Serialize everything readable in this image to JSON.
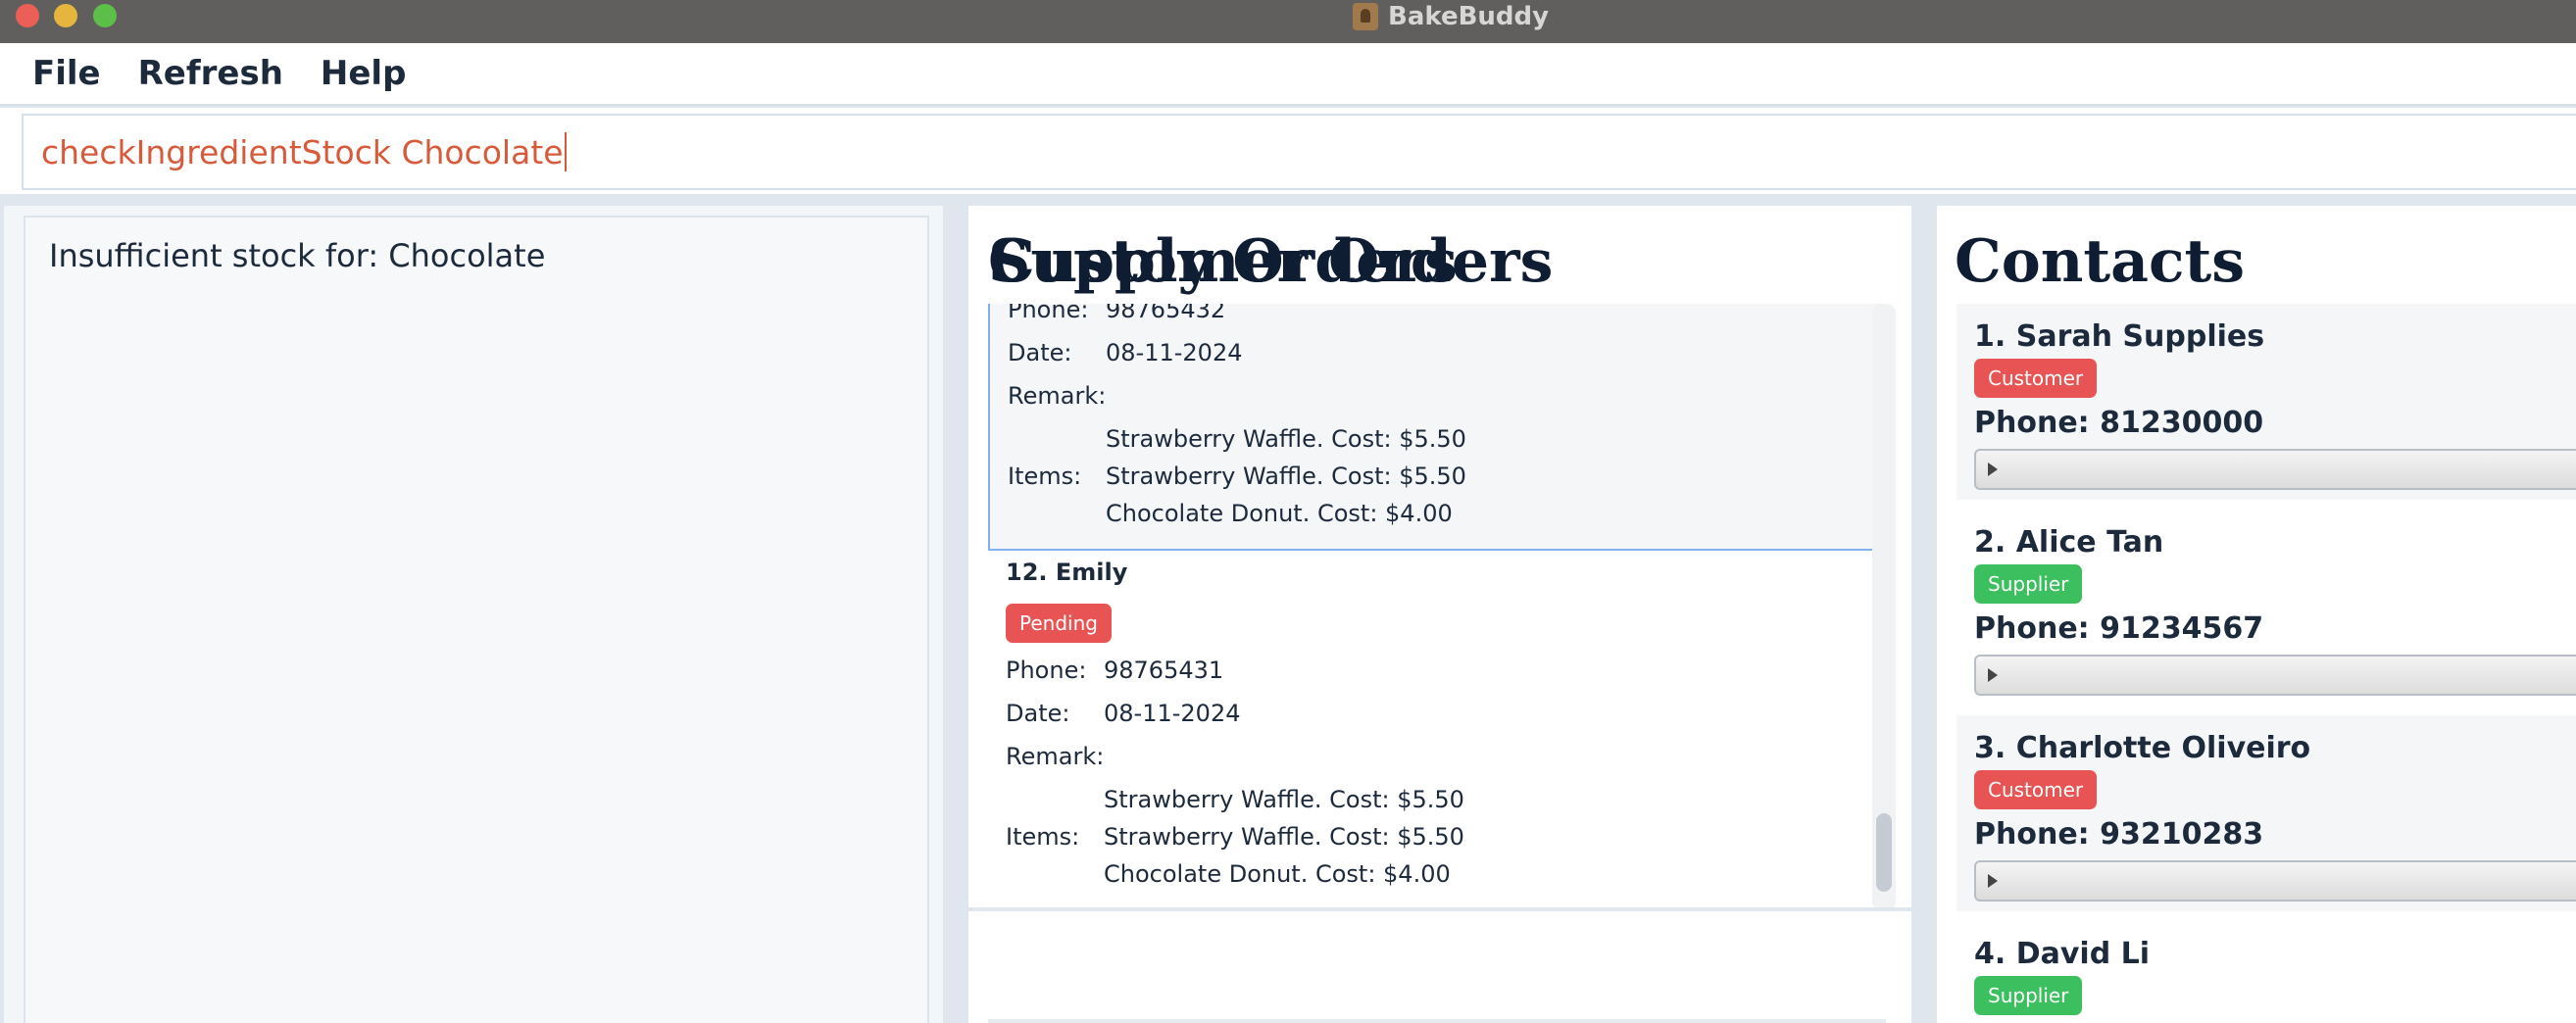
{
  "window": {
    "title": "BakeBuddy"
  },
  "menu": {
    "items": [
      "File",
      "Refresh",
      "Help"
    ]
  },
  "command": {
    "value": "checkIngredientStock Chocolate"
  },
  "result": {
    "message": "Insufficient stock for: Chocolate"
  },
  "customer_orders": {
    "heading": "Customer Orders",
    "labels": {
      "phone": "Phone:",
      "date": "Date:",
      "remark": "Remark:",
      "items": "Items:"
    },
    "orders": [
      {
        "phone": "98765432",
        "date": "08-11-2024",
        "remark": "",
        "items": [
          "Strawberry Waffle. Cost: $5.50",
          "Strawberry Waffle. Cost: $5.50",
          "Chocolate Donut. Cost: $4.00"
        ]
      },
      {
        "name": "12. Emily",
        "status": "Pending",
        "phone": "98765431",
        "date": "08-11-2024",
        "remark": "",
        "items": [
          "Strawberry Waffle. Cost: $5.50",
          "Strawberry Waffle. Cost: $5.50",
          "Chocolate Donut. Cost: $4.00"
        ]
      }
    ]
  },
  "supply_orders": {
    "heading": "Supply Orders"
  },
  "contacts": {
    "heading": "Contacts",
    "items": [
      {
        "name": "1. Sarah Supplies",
        "tag": "Customer",
        "tag_color": "#e85454",
        "phone": "Phone: 81230000"
      },
      {
        "name": "2. Alice Tan",
        "tag": "Supplier",
        "tag_color": "#3cbf5e",
        "phone": "Phone: 91234567"
      },
      {
        "name": "3. Charlotte Oliveiro",
        "tag": "Customer",
        "tag_color": "#e85454",
        "phone": "Phone: 93210283"
      },
      {
        "name": "4. David Li",
        "tag": "Supplier",
        "tag_color": "#3cbf5e"
      }
    ]
  }
}
